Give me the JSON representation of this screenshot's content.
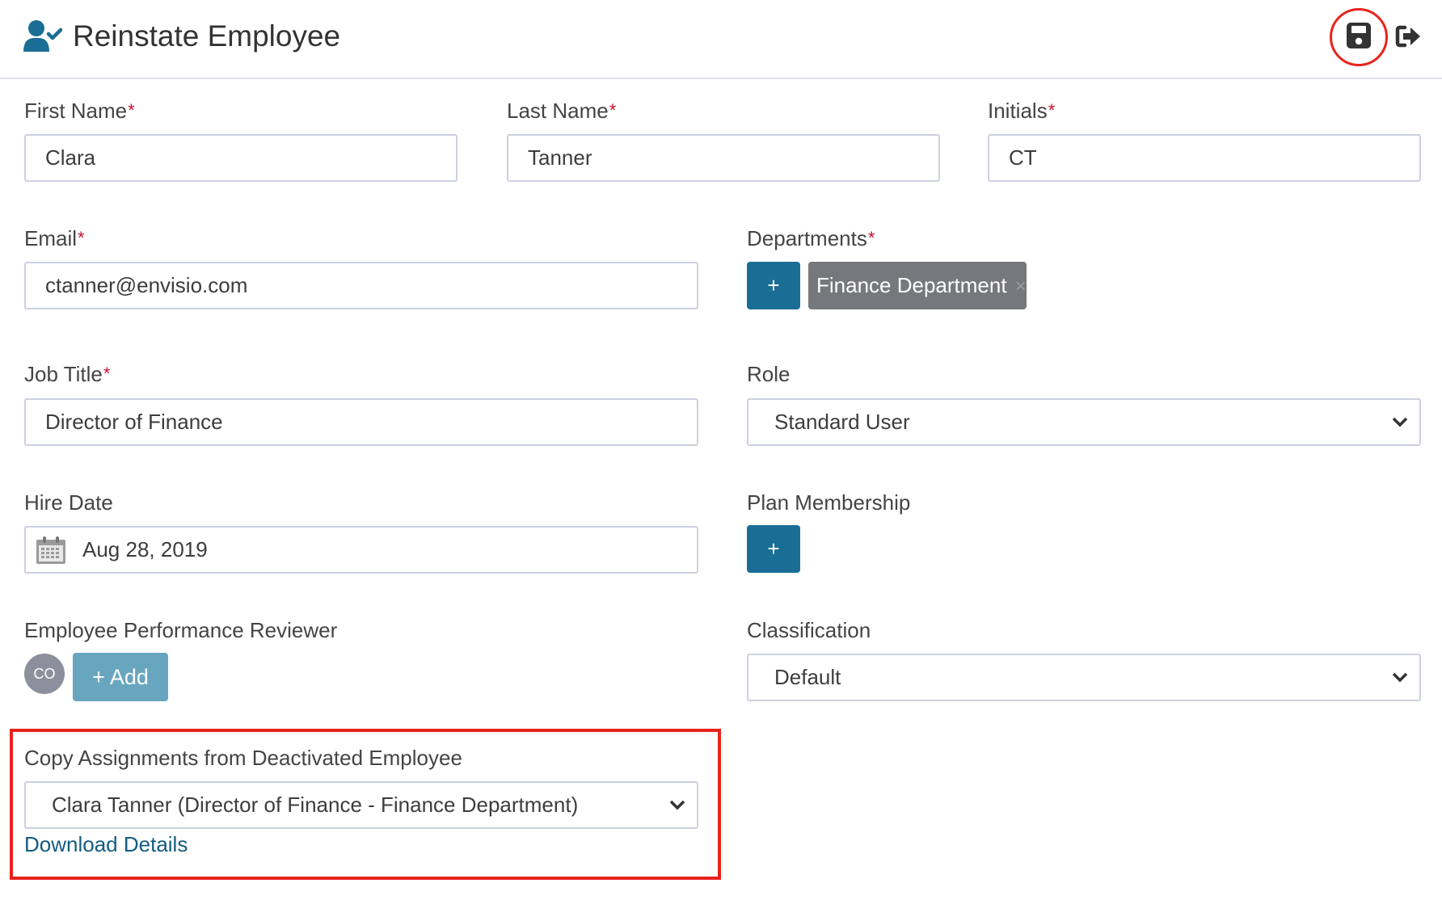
{
  "header": {
    "title": "Reinstate Employee",
    "title_icon": "user-check-icon",
    "save_icon": "save-icon",
    "exit_icon": "sign-out-icon",
    "highlight_color": "#e8231d"
  },
  "form": {
    "first_name": {
      "label": "First Name",
      "required": "*",
      "value": "Clara"
    },
    "last_name": {
      "label": "Last Name",
      "required": "*",
      "value": "Tanner"
    },
    "initials": {
      "label": "Initials",
      "required": "*",
      "value": "CT"
    },
    "email": {
      "label": "Email",
      "required": "*",
      "value": "ctanner@envisio.com"
    },
    "departments": {
      "label": "Departments",
      "required": "*",
      "add_label": "+",
      "tags": [
        {
          "label": "Finance Department",
          "remove": "×"
        }
      ]
    },
    "job_title": {
      "label": "Job Title",
      "required": "*",
      "value": "Director of Finance"
    },
    "role": {
      "label": "Role",
      "value": "Standard User"
    },
    "hire_date": {
      "label": "Hire Date",
      "value": "Aug 28, 2019",
      "icon": "calendar-icon"
    },
    "plan_membership": {
      "label": "Plan Membership",
      "add_label": "+"
    },
    "reviewer": {
      "label": "Employee Performance Reviewer",
      "avatar_initials": "CO",
      "add_label": "+ Add"
    },
    "classification": {
      "label": "Classification",
      "value": "Default"
    },
    "copy_assignments": {
      "label": "Copy Assignments from Deactivated Employee",
      "value": "Clara Tanner (Director of Finance - Finance Department)",
      "link": "Download Details"
    }
  },
  "colors": {
    "primary": "#1a6e96",
    "tag": "#77787b",
    "add_button": "#68a6c0",
    "link": "#135c80",
    "required": "#c8102e"
  }
}
